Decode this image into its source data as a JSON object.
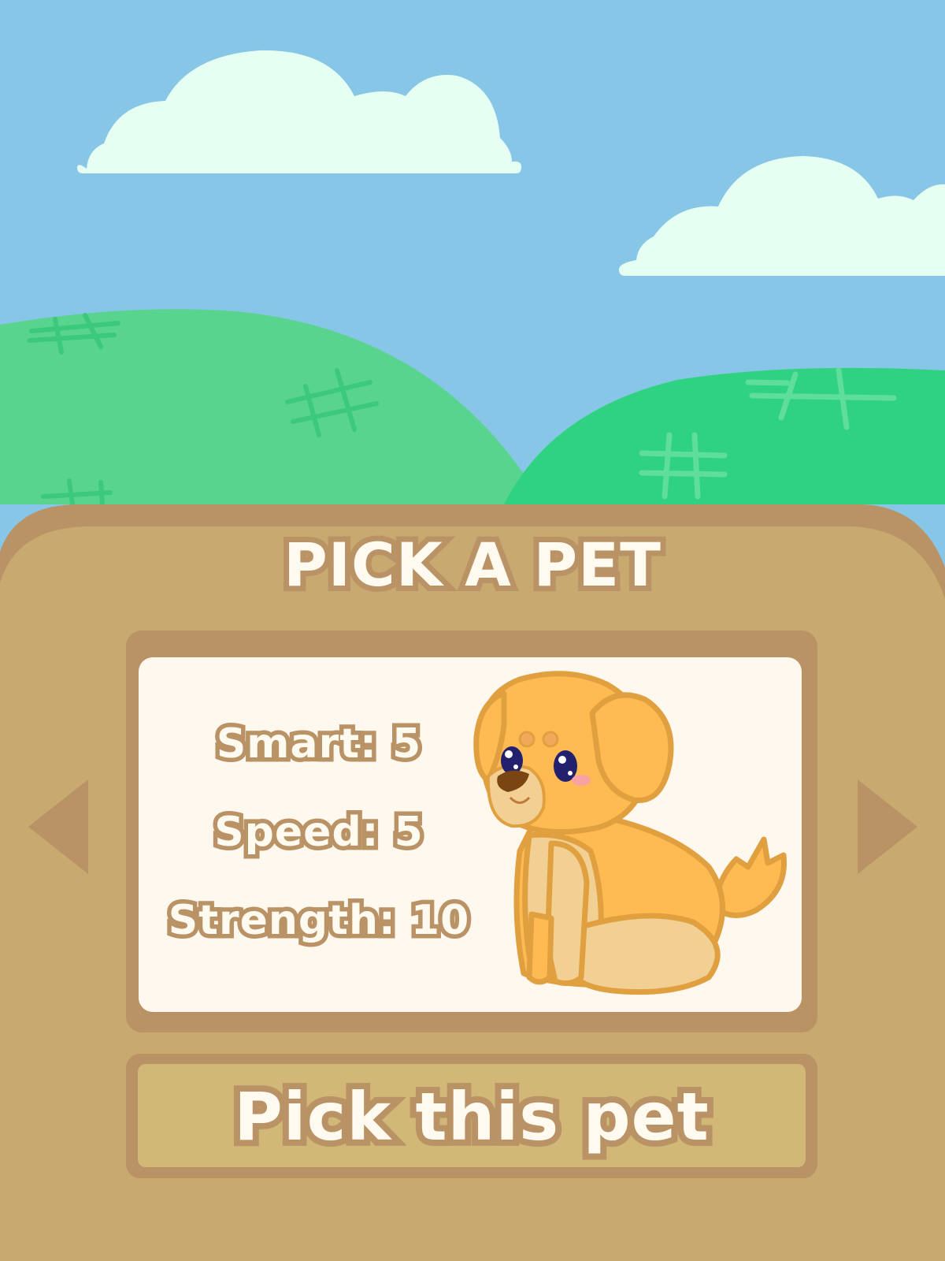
{
  "screen": {
    "title": "PICK A PET",
    "pet": {
      "species_icon": "dog-icon",
      "stats": [
        {
          "label": "Smart:",
          "value": "5",
          "text": "Smart: 5"
        },
        {
          "label": "Speed:",
          "value": "5",
          "text": "Speed: 5"
        },
        {
          "label": "Strength:",
          "value": "10",
          "text": "Strength: 10"
        }
      ]
    },
    "actions": {
      "pick_label": "Pick this pet",
      "prev_icon": "arrow-left-icon",
      "next_icon": "arrow-right-icon"
    }
  },
  "colors": {
    "sky": "#87c6e6",
    "cloud": "#e6fff3",
    "hill_left": "#58d48f",
    "hill_right": "#2fd280",
    "panel": "#c8a970",
    "panel_border": "#b99365",
    "card": "#fff8ee",
    "button": "#d2b877",
    "text_fill": "#fffaf0",
    "pet_fur": "#ffbb52"
  }
}
